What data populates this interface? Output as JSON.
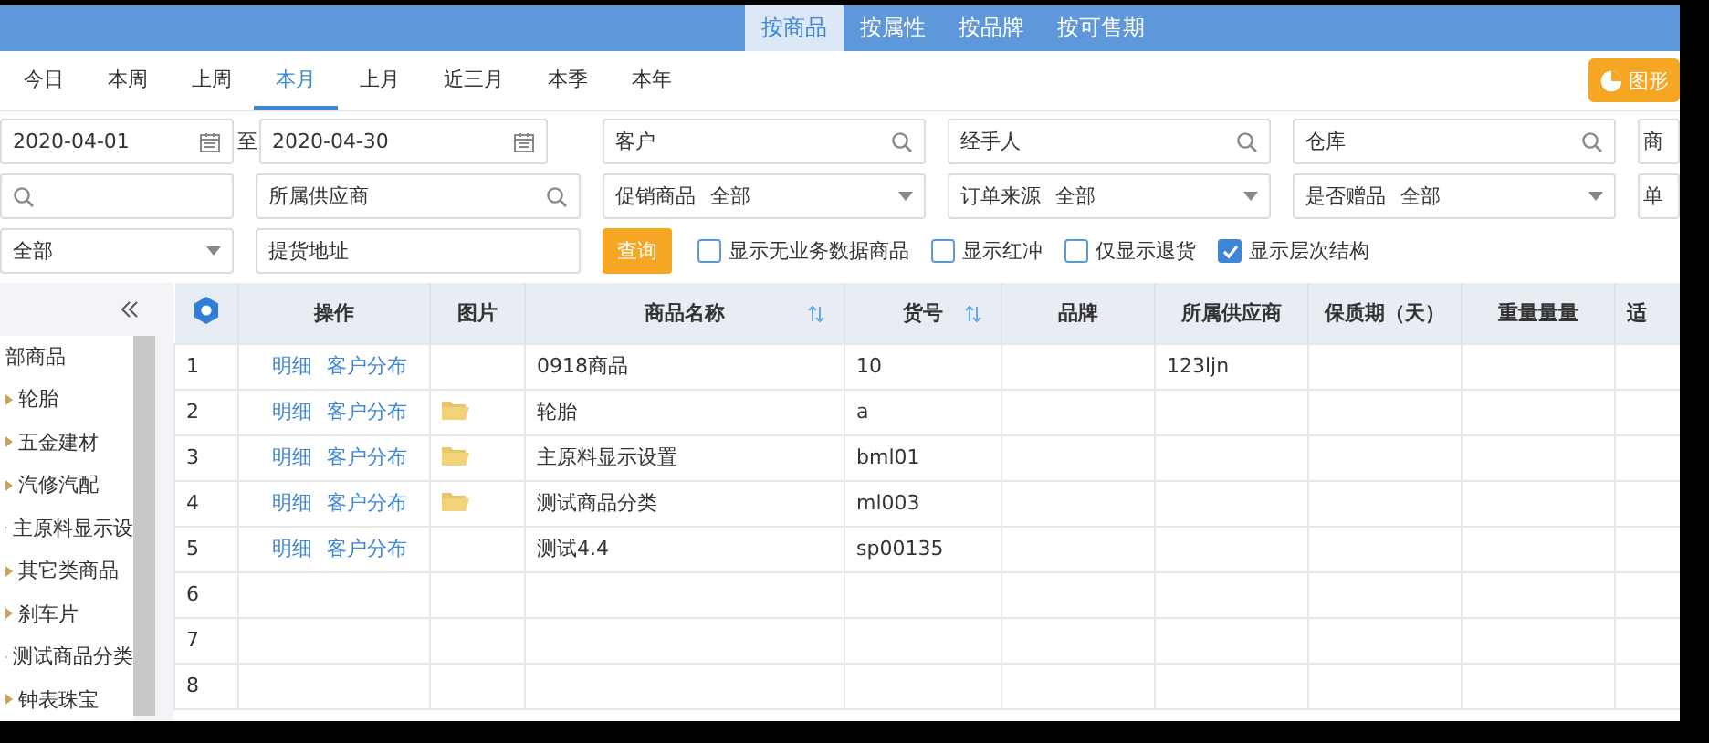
{
  "top_tabs": [
    {
      "label": "按商品",
      "selected": true
    },
    {
      "label": "按属性",
      "selected": false
    },
    {
      "label": "按品牌",
      "selected": false
    },
    {
      "label": "按可售期",
      "selected": false
    }
  ],
  "periods": [
    {
      "label": "今日",
      "selected": false
    },
    {
      "label": "本周",
      "selected": false
    },
    {
      "label": "上周",
      "selected": false
    },
    {
      "label": "本月",
      "selected": true
    },
    {
      "label": "上月",
      "selected": false
    },
    {
      "label": "近三月",
      "selected": false
    },
    {
      "label": "本季",
      "selected": false
    },
    {
      "label": "本年",
      "selected": false
    }
  ],
  "chart_button": {
    "label": "图形"
  },
  "filter_rows": [
    [
      {
        "kind": "date_range",
        "from": "2020-04-01",
        "separator": "至",
        "to": "2020-04-30"
      },
      {
        "kind": "search",
        "placeholder": "客户"
      },
      {
        "kind": "search",
        "placeholder": "经手人"
      },
      {
        "kind": "search",
        "placeholder": "仓库"
      },
      {
        "kind": "cut",
        "label": "商"
      }
    ],
    [
      {
        "kind": "search"
      },
      {
        "kind": "search",
        "placeholder": "所属供应商"
      },
      {
        "kind": "select",
        "label": "促销商品",
        "value": "全部"
      },
      {
        "kind": "select",
        "label": "订单来源",
        "value": "全部"
      },
      {
        "kind": "select",
        "label": "是否赠品",
        "value": "全部"
      },
      {
        "kind": "cut",
        "label": "单"
      }
    ],
    [
      {
        "kind": "select",
        "value": "全部"
      },
      {
        "kind": "text",
        "placeholder": "提货地址"
      }
    ]
  ],
  "query_button": {
    "label": "查询"
  },
  "checkboxes": [
    {
      "label": "显示无业务数据商品",
      "checked": false
    },
    {
      "label": "显示红冲",
      "checked": false
    },
    {
      "label": "仅显示退货",
      "checked": false
    },
    {
      "label": "显示层次结构",
      "checked": true
    }
  ],
  "tree": {
    "label": "部商品",
    "children": [
      {
        "label": "轮胎"
      },
      {
        "label": "五金建材"
      },
      {
        "label": "汽修汽配"
      },
      {
        "label": "主原料显示设"
      },
      {
        "label": "其它类商品"
      },
      {
        "label": "刹车片"
      },
      {
        "label": "测试商品分类"
      },
      {
        "label": "钟表珠宝"
      }
    ]
  },
  "table": {
    "columns": [
      {
        "label": "操作",
        "sortable": false
      },
      {
        "label": "图片",
        "sortable": false
      },
      {
        "label": "商品名称",
        "sortable": true
      },
      {
        "label": "货号",
        "sortable": true
      },
      {
        "label": "品牌",
        "sortable": false
      },
      {
        "label": "所属供应商",
        "sortable": false
      },
      {
        "label": "保质期（天）",
        "sortable": false
      },
      {
        "label": "重量量量",
        "sortable": false
      },
      {
        "label": "适"
      }
    ],
    "rows": [
      {
        "index": "1",
        "actions": [
          "明细",
          "客户分布"
        ],
        "picture": false,
        "name": "0918商品",
        "code": "10",
        "supplier": "123ljn"
      },
      {
        "index": "2",
        "actions": [
          "明细",
          "客户分布"
        ],
        "picture": true,
        "name": "轮胎",
        "code": "a"
      },
      {
        "index": "3",
        "actions": [
          "明细",
          "客户分布"
        ],
        "picture": true,
        "name": "主原料显示设置",
        "code": "bml01"
      },
      {
        "index": "4",
        "actions": [
          "明细",
          "客户分布"
        ],
        "picture": true,
        "name": "测试商品分类",
        "code": "ml003"
      },
      {
        "index": "5",
        "actions": [
          "明细",
          "客户分布"
        ],
        "picture": false,
        "name": "测试4.4",
        "code": "sp00135"
      },
      {
        "index": "6"
      },
      {
        "index": "7"
      },
      {
        "index": "8"
      }
    ]
  }
}
